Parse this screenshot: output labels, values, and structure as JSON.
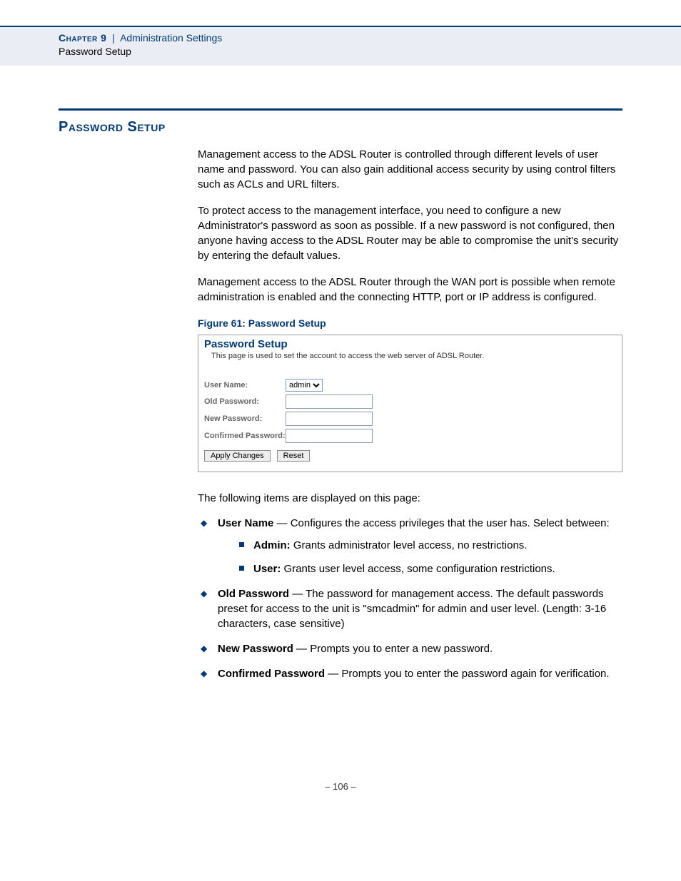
{
  "header": {
    "chapter": "Chapter 9",
    "divider": "|",
    "section": "Administration Settings",
    "sub": "Password Setup"
  },
  "section": {
    "title": "Password Setup",
    "p1": "Management access to the ADSL Router is controlled through different levels of user name and password. You can also gain additional access security by using control filters such as ACLs and URL filters.",
    "p2": "To protect access to the management interface, you need to configure a new Administrator's password as soon as possible. If a new password is not configured, then anyone having access to the ADSL Router may be able to compromise the unit's security by entering the default values.",
    "p3": "Management access to the ADSL Router through the WAN port is possible when remote administration is enabled and the connecting HTTP, port or IP address is configured.",
    "figCaption": "Figure 61:  Password Setup",
    "intro": "The following items are displayed on this page:"
  },
  "figure": {
    "title": "Password Setup",
    "desc": "This page is used to set the account to access the web server of ADSL Router.",
    "fields": {
      "userName": "User Name:",
      "oldPassword": "Old Password:",
      "newPassword": "New Password:",
      "confirmedPassword": "Confirmed Password:"
    },
    "userSelect": "admin",
    "buttons": {
      "apply": "Apply Changes",
      "reset": "Reset"
    }
  },
  "items": {
    "userName": {
      "label": "User Name",
      "text": " — Configures the access privileges that the user has. Select between:",
      "adminLabel": "Admin:",
      "adminText": " Grants administrator level access, no restrictions.",
      "userLabel": "User:",
      "userText": " Grants user level access, some configuration restrictions."
    },
    "oldPassword": {
      "label": "Old Password",
      "text": " — The password for management access. The default passwords preset for access to the unit is \"smcadmin\" for admin and user level. (Length: 3-16 characters, case sensitive)"
    },
    "newPassword": {
      "label": "New Password",
      "text": " — Prompts you to enter a new password."
    },
    "confirmedPassword": {
      "label": "Confirmed Password",
      "text": " — Prompts you to enter the password again for verification."
    }
  },
  "pageNumber": "–  106  –"
}
